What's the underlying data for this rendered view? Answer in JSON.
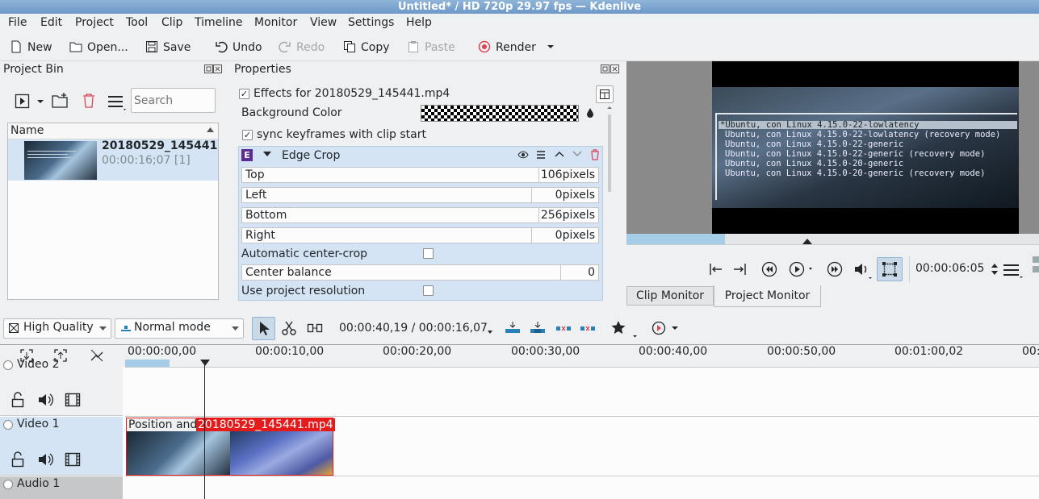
{
  "window": {
    "title": "Untitled* / HD 720p 29.97 fps — Kdenlive"
  },
  "menu": [
    "File",
    "Edit",
    "Project",
    "Tool",
    "Clip",
    "Timeline",
    "Monitor",
    "View",
    "Settings",
    "Help"
  ],
  "toolbar": {
    "new": "New",
    "open": "Open...",
    "save": "Save",
    "undo": "Undo",
    "redo": "Redo",
    "copy": "Copy",
    "paste": "Paste",
    "render": "Render"
  },
  "project_bin": {
    "title": "Project Bin",
    "search_placeholder": "Search",
    "column_name": "Name",
    "clip": {
      "name": "20180529_145441",
      "duration": "00:00:16;07 [1]"
    }
  },
  "properties": {
    "title": "Properties",
    "effects_for": "Effects for 20180529_145441.mp4",
    "background_color_label": "Background Color",
    "sync_label": "sync keyframes with clip start",
    "effect_badge": "E",
    "effect_name": "Edge Crop",
    "params": [
      {
        "label": "Top",
        "value": "106pixels"
      },
      {
        "label": "Left",
        "value": "0pixels"
      },
      {
        "label": "Bottom",
        "value": "256pixels"
      },
      {
        "label": "Right",
        "value": "0pixels"
      }
    ],
    "auto_center_label": "Automatic center-crop",
    "center_balance_label": "Center balance",
    "center_balance_value": "0",
    "use_project_res_label": "Use project resolution"
  },
  "monitor": {
    "timecode": "00:00:06:05",
    "tabs": [
      "Clip Monitor",
      "Project Monitor"
    ],
    "grub_lines": [
      "*Ubuntu, con Linux 4.15.0-22-lowlatency",
      "Ubuntu, con Linux 4.15.0-22-lowlatency (recovery mode)",
      "Ubuntu, con Linux 4.15.0-22-generic",
      "Ubuntu, con Linux 4.15.0-22-generic (recovery mode)",
      "Ubuntu, con Linux 4.15.0-20-generic",
      "Ubuntu, con Linux 4.15.0-20-generic (recovery mode)"
    ]
  },
  "timeline_toolbar": {
    "quality": "High Quality",
    "mode": "Normal mode",
    "position": "00:00:40,19 / 00:00:16,07"
  },
  "ruler": [
    "00:00:00,00",
    "00:00:10,00",
    "00:00:20,00",
    "00:00:30,00",
    "00:00:40,00",
    "00:00:50,00",
    "00:01:00,02",
    "00:01"
  ],
  "tracks": [
    {
      "name": "Video 2"
    },
    {
      "name": "Video 1"
    },
    {
      "name": "Audio 1"
    }
  ],
  "clip_on_timeline": {
    "effect_label": "Position and",
    "name": "20180529_145441.mp4"
  },
  "colors": {
    "selection": "#d4e4f4",
    "clip_red": "#e51b1b",
    "accent": "#3daee9"
  }
}
